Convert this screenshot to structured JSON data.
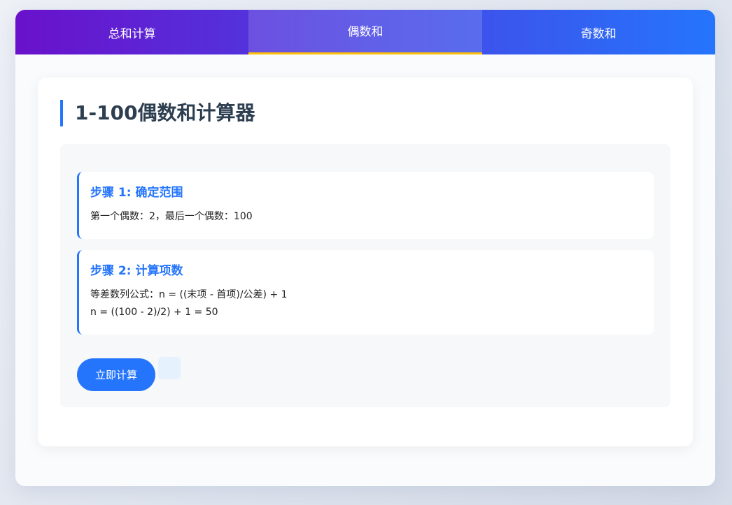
{
  "tabs": [
    {
      "label": "总和计算",
      "active": false
    },
    {
      "label": "偶数和",
      "active": true
    },
    {
      "label": "奇数和",
      "active": false
    }
  ],
  "main": {
    "title": "1-100偶数和计算器",
    "steps": [
      {
        "title": "步骤 1: 确定范围",
        "lines": [
          "第一个偶数：2，最后一个偶数：100"
        ]
      },
      {
        "title": "步骤 2: 计算项数",
        "lines": [
          "等差数列公式：n = ((末项 - 首项)/公差) + 1",
          "n = ((100 - 2)/2) + 1 = 50"
        ]
      }
    ],
    "calculate_button": "立即计算",
    "result": ""
  },
  "colors": {
    "accent": "#2575fc",
    "gradient_start": "#6a11cb",
    "gradient_end": "#2575fc",
    "active_tab_indicator": "#ffc107",
    "title_text": "#2c3e50"
  }
}
